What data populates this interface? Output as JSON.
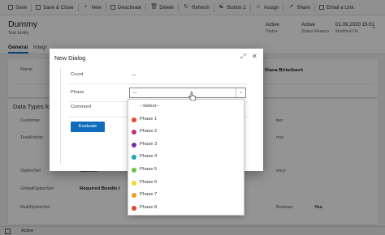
{
  "toolbar": {
    "items": [
      {
        "label": "Save",
        "icon": "save-icon"
      },
      {
        "label": "Save & Close",
        "icon": "save-close-icon"
      },
      {
        "label": "New",
        "icon": "plus-icon"
      },
      {
        "label": "Deactivate",
        "icon": "deactivate-icon"
      },
      {
        "label": "Delete",
        "icon": "delete-icon"
      },
      {
        "label": "Refresh",
        "icon": "refresh-icon"
      },
      {
        "label": "Button 2",
        "icon": "button-icon"
      },
      {
        "label": "Assign",
        "icon": "assign-icon"
      },
      {
        "label": "Share",
        "icon": "share-icon"
      },
      {
        "label": "Email a Link",
        "icon": "email-icon"
      }
    ]
  },
  "header": {
    "title": "Dummy",
    "entity": "Test Entity",
    "status_value": "Active",
    "status_label": "Status",
    "status_reason_value": "Active",
    "status_reason_label": "Status Reason",
    "modified_value": "01.09.2020 15:01",
    "modified_label": "Modified On"
  },
  "tabs": {
    "general": "General",
    "integration": "Integr"
  },
  "form": {
    "name_label": "Name",
    "owner_value": "Diana Birkelbach",
    "section_title": "Data Types for",
    "customer_label": "Customer",
    "testactivity_label": "TestActivity",
    "optionset_label": "OptionSet",
    "optionset_value": "Options",
    "globaloptionset_label": "GlobalOptionSet",
    "globaloptionset_value": "Required Bundle I",
    "multioptionset_label": "MultiOptionSet",
    "right_label_1": "ber",
    "right_label_2": "mal",
    "right_label_3": "ency",
    "boolean_label": "Boolean",
    "boolean_value": "Yes"
  },
  "status_bar": {
    "status": "Active"
  },
  "dialog": {
    "title": "New Dialog",
    "expand_icon": "expand-icon",
    "close_icon": "close-icon",
    "count_label": "Count",
    "count_value": "---",
    "phase_label": "Phase",
    "phase_value": "---",
    "comment_label": "Comment",
    "evaluate_label": "Evaluate"
  },
  "dropdown": {
    "options": [
      {
        "label": "--Select--",
        "color": ""
      },
      {
        "label": "Phase 1",
        "color": "#e8442e"
      },
      {
        "label": "Phase 2",
        "color": "#c2307a"
      },
      {
        "label": "Phase 3",
        "color": "#7a2ba0"
      },
      {
        "label": "Phase 4",
        "color": "#1fa3b5"
      },
      {
        "label": "Phase 5",
        "color": "#6cc04a"
      },
      {
        "label": "Phase 6",
        "color": "#f5d327"
      },
      {
        "label": "Phase 7",
        "color": "#f29a1e"
      },
      {
        "label": "Phase 8",
        "color": "#e8442e"
      }
    ]
  }
}
